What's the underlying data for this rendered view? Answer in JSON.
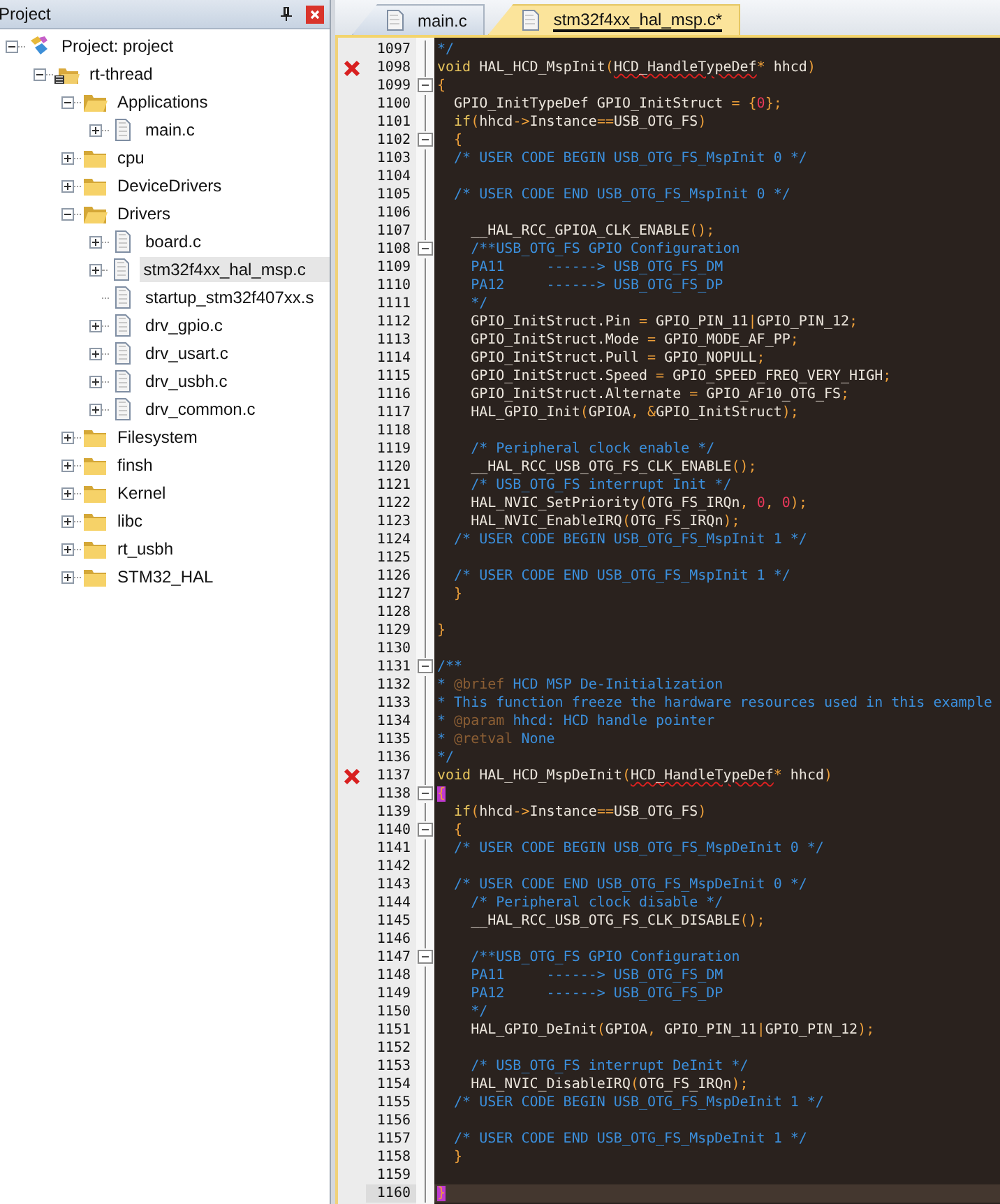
{
  "project_panel": {
    "title": "Project",
    "tree": [
      {
        "label": "Project: project",
        "kind": "project",
        "expandable": true,
        "expanded": true,
        "selected": false,
        "children": [
          {
            "label": "rt-thread",
            "kind": "target",
            "expandable": true,
            "expanded": true,
            "selected": false,
            "children": [
              {
                "label": "Applications",
                "kind": "folder_open",
                "expandable": true,
                "expanded": true,
                "selected": false,
                "children": [
                  {
                    "label": "main.c",
                    "kind": "file",
                    "expandable": true,
                    "expanded": false,
                    "selected": false
                  }
                ]
              },
              {
                "label": "cpu",
                "kind": "folder",
                "expandable": true,
                "expanded": false,
                "selected": false
              },
              {
                "label": "DeviceDrivers",
                "kind": "folder",
                "expandable": true,
                "expanded": false,
                "selected": false
              },
              {
                "label": "Drivers",
                "kind": "folder_open",
                "expandable": true,
                "expanded": true,
                "selected": false,
                "children": [
                  {
                    "label": "board.c",
                    "kind": "file",
                    "expandable": true,
                    "expanded": false,
                    "selected": false
                  },
                  {
                    "label": "stm32f4xx_hal_msp.c",
                    "kind": "file",
                    "expandable": true,
                    "expanded": false,
                    "selected": true
                  },
                  {
                    "label": "startup_stm32f407xx.s",
                    "kind": "file",
                    "expandable": false,
                    "selected": false
                  },
                  {
                    "label": "drv_gpio.c",
                    "kind": "file",
                    "expandable": true,
                    "expanded": false,
                    "selected": false
                  },
                  {
                    "label": "drv_usart.c",
                    "kind": "file",
                    "expandable": true,
                    "expanded": false,
                    "selected": false
                  },
                  {
                    "label": "drv_usbh.c",
                    "kind": "file",
                    "expandable": true,
                    "expanded": false,
                    "selected": false
                  },
                  {
                    "label": "drv_common.c",
                    "kind": "file",
                    "expandable": true,
                    "expanded": false,
                    "selected": false
                  }
                ]
              },
              {
                "label": "Filesystem",
                "kind": "folder",
                "expandable": true,
                "expanded": false,
                "selected": false
              },
              {
                "label": "finsh",
                "kind": "folder",
                "expandable": true,
                "expanded": false,
                "selected": false
              },
              {
                "label": "Kernel",
                "kind": "folder",
                "expandable": true,
                "expanded": false,
                "selected": false
              },
              {
                "label": "libc",
                "kind": "folder",
                "expandable": true,
                "expanded": false,
                "selected": false
              },
              {
                "label": "rt_usbh",
                "kind": "folder",
                "expandable": true,
                "expanded": false,
                "selected": false
              },
              {
                "label": "STM32_HAL",
                "kind": "folder",
                "expandable": true,
                "expanded": false,
                "selected": false
              }
            ]
          }
        ]
      }
    ]
  },
  "editor": {
    "tabs": [
      {
        "label": "main.c",
        "selected": false
      },
      {
        "label": "stm32f4xx_hal_msp.c*",
        "selected": true
      }
    ],
    "lines": [
      {
        "number": "1097",
        "error": false,
        "current": false,
        "foldable": false,
        "segments": [
          {
            "kind": "comment",
            "text": "*/"
          }
        ]
      },
      {
        "number": "1098",
        "error": true,
        "current": false,
        "foldable": false,
        "segments": [
          {
            "kind": "keyword",
            "text": "void"
          },
          {
            "kind": "plain",
            "text": " HAL_HCD_MspInit"
          },
          {
            "kind": "punct",
            "text": "("
          },
          {
            "kind": "flagged",
            "text": "HCD_HandleTypeDef"
          },
          {
            "kind": "punct",
            "text": "*"
          },
          {
            "kind": "plain",
            "text": " hhcd"
          },
          {
            "kind": "punct",
            "text": ")"
          }
        ]
      },
      {
        "number": "1099",
        "error": false,
        "current": false,
        "foldable": true,
        "segments": [
          {
            "kind": "punct",
            "text": "{"
          }
        ]
      },
      {
        "number": "1100",
        "error": false,
        "current": false,
        "foldable": false,
        "segments": [
          {
            "kind": "plain",
            "text": "  GPIO_InitTypeDef GPIO_InitStruct "
          },
          {
            "kind": "punct",
            "text": "= {"
          },
          {
            "kind": "number",
            "text": "0"
          },
          {
            "kind": "punct",
            "text": "};"
          }
        ]
      },
      {
        "number": "1101",
        "error": false,
        "current": false,
        "foldable": false,
        "segments": [
          {
            "kind": "keyword",
            "text": "  if"
          },
          {
            "kind": "punct",
            "text": "("
          },
          {
            "kind": "plain",
            "text": "hhcd"
          },
          {
            "kind": "punct",
            "text": "->"
          },
          {
            "kind": "plain",
            "text": "Instance"
          },
          {
            "kind": "punct",
            "text": "=="
          },
          {
            "kind": "plain",
            "text": "USB_OTG_FS"
          },
          {
            "kind": "punct",
            "text": ")"
          }
        ]
      },
      {
        "number": "1102",
        "error": false,
        "current": false,
        "foldable": true,
        "segments": [
          {
            "kind": "punct",
            "text": "  {"
          }
        ]
      },
      {
        "number": "1103",
        "error": false,
        "current": false,
        "foldable": false,
        "segments": [
          {
            "kind": "comment",
            "text": "  /* USER CODE BEGIN USB_OTG_FS_MspInit 0 */"
          }
        ]
      },
      {
        "number": "1104",
        "error": false,
        "current": false,
        "foldable": false
      },
      {
        "number": "1105",
        "error": false,
        "current": false,
        "foldable": false,
        "segments": [
          {
            "kind": "comment",
            "text": "  /* USER CODE END USB_OTG_FS_MspInit 0 */"
          }
        ]
      },
      {
        "number": "1106",
        "error": false,
        "current": false,
        "foldable": false
      },
      {
        "number": "1107",
        "error": false,
        "current": false,
        "foldable": false,
        "segments": [
          {
            "kind": "plain",
            "text": "    __HAL_RCC_GPIOA_CLK_ENABLE"
          },
          {
            "kind": "punct",
            "text": "();"
          }
        ]
      },
      {
        "number": "1108",
        "error": false,
        "current": false,
        "foldable": true,
        "segments": [
          {
            "kind": "comment",
            "text": "    /**USB_OTG_FS GPIO Configuration"
          }
        ]
      },
      {
        "number": "1109",
        "error": false,
        "current": false,
        "foldable": false,
        "segments": [
          {
            "kind": "comment",
            "text": "    PA11     ------> USB_OTG_FS_DM"
          }
        ]
      },
      {
        "number": "1110",
        "error": false,
        "current": false,
        "foldable": false,
        "segments": [
          {
            "kind": "comment",
            "text": "    PA12     ------> USB_OTG_FS_DP"
          }
        ]
      },
      {
        "number": "1111",
        "error": false,
        "current": false,
        "foldable": false,
        "segments": [
          {
            "kind": "comment",
            "text": "    */"
          }
        ]
      },
      {
        "number": "1112",
        "error": false,
        "current": false,
        "foldable": false,
        "segments": [
          {
            "kind": "plain",
            "text": "    GPIO_InitStruct.Pin "
          },
          {
            "kind": "punct",
            "text": "="
          },
          {
            "kind": "plain",
            "text": " GPIO_PIN_11"
          },
          {
            "kind": "punct",
            "text": "|"
          },
          {
            "kind": "plain",
            "text": "GPIO_PIN_12"
          },
          {
            "kind": "punct",
            "text": ";"
          }
        ]
      },
      {
        "number": "1113",
        "error": false,
        "current": false,
        "foldable": false,
        "segments": [
          {
            "kind": "plain",
            "text": "    GPIO_InitStruct.Mode "
          },
          {
            "kind": "punct",
            "text": "="
          },
          {
            "kind": "plain",
            "text": " GPIO_MODE_AF_PP"
          },
          {
            "kind": "punct",
            "text": ";"
          }
        ]
      },
      {
        "number": "1114",
        "error": false,
        "current": false,
        "foldable": false,
        "segments": [
          {
            "kind": "plain",
            "text": "    GPIO_InitStruct.Pull "
          },
          {
            "kind": "punct",
            "text": "="
          },
          {
            "kind": "plain",
            "text": " GPIO_NOPULL"
          },
          {
            "kind": "punct",
            "text": ";"
          }
        ]
      },
      {
        "number": "1115",
        "error": false,
        "current": false,
        "foldable": false,
        "segments": [
          {
            "kind": "plain",
            "text": "    GPIO_InitStruct.Speed "
          },
          {
            "kind": "punct",
            "text": "="
          },
          {
            "kind": "plain",
            "text": " GPIO_SPEED_FREQ_VERY_HIGH"
          },
          {
            "kind": "punct",
            "text": ";"
          }
        ]
      },
      {
        "number": "1116",
        "error": false,
        "current": false,
        "foldable": false,
        "segments": [
          {
            "kind": "plain",
            "text": "    GPIO_InitStruct.Alternate "
          },
          {
            "kind": "punct",
            "text": "="
          },
          {
            "kind": "plain",
            "text": " GPIO_AF10_OTG_FS"
          },
          {
            "kind": "punct",
            "text": ";"
          }
        ]
      },
      {
        "number": "1117",
        "error": false,
        "current": false,
        "foldable": false,
        "segments": [
          {
            "kind": "plain",
            "text": "    HAL_GPIO_Init"
          },
          {
            "kind": "punct",
            "text": "("
          },
          {
            "kind": "plain",
            "text": "GPIOA"
          },
          {
            "kind": "punct",
            "text": ", &"
          },
          {
            "kind": "plain",
            "text": "GPIO_InitStruct"
          },
          {
            "kind": "punct",
            "text": ");"
          }
        ]
      },
      {
        "number": "1118",
        "error": false,
        "current": false,
        "foldable": false
      },
      {
        "number": "1119",
        "error": false,
        "current": false,
        "foldable": false,
        "segments": [
          {
            "kind": "comment",
            "text": "    /* Peripheral clock enable */"
          }
        ]
      },
      {
        "number": "1120",
        "error": false,
        "current": false,
        "foldable": false,
        "segments": [
          {
            "kind": "plain",
            "text": "    __HAL_RCC_USB_OTG_FS_CLK_ENABLE"
          },
          {
            "kind": "punct",
            "text": "();"
          }
        ]
      },
      {
        "number": "1121",
        "error": false,
        "current": false,
        "foldable": false,
        "segments": [
          {
            "kind": "comment",
            "text": "    /* USB_OTG_FS interrupt Init */"
          }
        ]
      },
      {
        "number": "1122",
        "error": false,
        "current": false,
        "foldable": false,
        "segments": [
          {
            "kind": "plain",
            "text": "    HAL_NVIC_SetPriority"
          },
          {
            "kind": "punct",
            "text": "("
          },
          {
            "kind": "plain",
            "text": "OTG_FS_IRQn"
          },
          {
            "kind": "punct",
            "text": ", "
          },
          {
            "kind": "number",
            "text": "0"
          },
          {
            "kind": "punct",
            "text": ", "
          },
          {
            "kind": "number",
            "text": "0"
          },
          {
            "kind": "punct",
            "text": ");"
          }
        ]
      },
      {
        "number": "1123",
        "error": false,
        "current": false,
        "foldable": false,
        "segments": [
          {
            "kind": "plain",
            "text": "    HAL_NVIC_EnableIRQ"
          },
          {
            "kind": "punct",
            "text": "("
          },
          {
            "kind": "plain",
            "text": "OTG_FS_IRQn"
          },
          {
            "kind": "punct",
            "text": ");"
          }
        ]
      },
      {
        "number": "1124",
        "error": false,
        "current": false,
        "foldable": false,
        "segments": [
          {
            "kind": "comment",
            "text": "  /* USER CODE BEGIN USB_OTG_FS_MspInit 1 */"
          }
        ]
      },
      {
        "number": "1125",
        "error": false,
        "current": false,
        "foldable": false
      },
      {
        "number": "1126",
        "error": false,
        "current": false,
        "foldable": false,
        "segments": [
          {
            "kind": "comment",
            "text": "  /* USER CODE END USB_OTG_FS_MspInit 1 */"
          }
        ]
      },
      {
        "number": "1127",
        "error": false,
        "current": false,
        "foldable": false,
        "segments": [
          {
            "kind": "punct",
            "text": "  }"
          }
        ]
      },
      {
        "number": "1128",
        "error": false,
        "current": false,
        "foldable": false
      },
      {
        "number": "1129",
        "error": false,
        "current": false,
        "foldable": false,
        "segments": [
          {
            "kind": "punct",
            "text": "}"
          }
        ]
      },
      {
        "number": "1130",
        "error": false,
        "current": false,
        "foldable": false
      },
      {
        "number": "1131",
        "error": false,
        "current": false,
        "foldable": true,
        "segments": [
          {
            "kind": "comment",
            "text": "/**"
          }
        ]
      },
      {
        "number": "1132",
        "error": false,
        "current": false,
        "foldable": false,
        "segments": [
          {
            "kind": "comment",
            "text": "* "
          },
          {
            "kind": "doctag",
            "text": "@brief"
          },
          {
            "kind": "comment",
            "text": " HCD MSP De-Initialization"
          }
        ]
      },
      {
        "number": "1133",
        "error": false,
        "current": false,
        "foldable": false,
        "segments": [
          {
            "kind": "comment",
            "text": "* This function freeze the hardware resources used in this example"
          }
        ]
      },
      {
        "number": "1134",
        "error": false,
        "current": false,
        "foldable": false,
        "segments": [
          {
            "kind": "comment",
            "text": "* "
          },
          {
            "kind": "doctag",
            "text": "@param"
          },
          {
            "kind": "comment",
            "text": " hhcd: HCD handle pointer"
          }
        ]
      },
      {
        "number": "1135",
        "error": false,
        "current": false,
        "foldable": false,
        "segments": [
          {
            "kind": "comment",
            "text": "* "
          },
          {
            "kind": "doctag",
            "text": "@retval"
          },
          {
            "kind": "comment",
            "text": " None"
          }
        ]
      },
      {
        "number": "1136",
        "error": false,
        "current": false,
        "foldable": false,
        "segments": [
          {
            "kind": "comment",
            "text": "*/"
          }
        ]
      },
      {
        "number": "1137",
        "error": true,
        "current": false,
        "foldable": false,
        "segments": [
          {
            "kind": "keyword",
            "text": "void"
          },
          {
            "kind": "plain",
            "text": " HAL_HCD_MspDeInit"
          },
          {
            "kind": "punct",
            "text": "("
          },
          {
            "kind": "flagged",
            "text": "HCD_HandleTypeDef"
          },
          {
            "kind": "punct",
            "text": "*"
          },
          {
            "kind": "plain",
            "text": " hhcd"
          },
          {
            "kind": "punct",
            "text": ")"
          }
        ]
      },
      {
        "number": "1138",
        "error": false,
        "current": false,
        "foldable": true,
        "segments": [
          {
            "kind": "match",
            "text": "{"
          }
        ]
      },
      {
        "number": "1139",
        "error": false,
        "current": false,
        "foldable": false,
        "segments": [
          {
            "kind": "keyword",
            "text": "  if"
          },
          {
            "kind": "punct",
            "text": "("
          },
          {
            "kind": "plain",
            "text": "hhcd"
          },
          {
            "kind": "punct",
            "text": "->"
          },
          {
            "kind": "plain",
            "text": "Instance"
          },
          {
            "kind": "punct",
            "text": "=="
          },
          {
            "kind": "plain",
            "text": "USB_OTG_FS"
          },
          {
            "kind": "punct",
            "text": ")"
          }
        ]
      },
      {
        "number": "1140",
        "error": false,
        "current": false,
        "foldable": true,
        "segments": [
          {
            "kind": "punct",
            "text": "  {"
          }
        ]
      },
      {
        "number": "1141",
        "error": false,
        "current": false,
        "foldable": false,
        "segments": [
          {
            "kind": "comment",
            "text": "  /* USER CODE BEGIN USB_OTG_FS_MspDeInit 0 */"
          }
        ]
      },
      {
        "number": "1142",
        "error": false,
        "current": false,
        "foldable": false
      },
      {
        "number": "1143",
        "error": false,
        "current": false,
        "foldable": false,
        "segments": [
          {
            "kind": "comment",
            "text": "  /* USER CODE END USB_OTG_FS_MspDeInit 0 */"
          }
        ]
      },
      {
        "number": "1144",
        "error": false,
        "current": false,
        "foldable": false,
        "segments": [
          {
            "kind": "comment",
            "text": "    /* Peripheral clock disable */"
          }
        ]
      },
      {
        "number": "1145",
        "error": false,
        "current": false,
        "foldable": false,
        "segments": [
          {
            "kind": "plain",
            "text": "    __HAL_RCC_USB_OTG_FS_CLK_DISABLE"
          },
          {
            "kind": "punct",
            "text": "();"
          }
        ]
      },
      {
        "number": "1146",
        "error": false,
        "current": false,
        "foldable": false
      },
      {
        "number": "1147",
        "error": false,
        "current": false,
        "foldable": true,
        "segments": [
          {
            "kind": "comment",
            "text": "    /**USB_OTG_FS GPIO Configuration"
          }
        ]
      },
      {
        "number": "1148",
        "error": false,
        "current": false,
        "foldable": false,
        "segments": [
          {
            "kind": "comment",
            "text": "    PA11     ------> USB_OTG_FS_DM"
          }
        ]
      },
      {
        "number": "1149",
        "error": false,
        "current": false,
        "foldable": false,
        "segments": [
          {
            "kind": "comment",
            "text": "    PA12     ------> USB_OTG_FS_DP"
          }
        ]
      },
      {
        "number": "1150",
        "error": false,
        "current": false,
        "foldable": false,
        "segments": [
          {
            "kind": "comment",
            "text": "    */"
          }
        ]
      },
      {
        "number": "1151",
        "error": false,
        "current": false,
        "foldable": false,
        "segments": [
          {
            "kind": "plain",
            "text": "    HAL_GPIO_DeInit"
          },
          {
            "kind": "punct",
            "text": "("
          },
          {
            "kind": "plain",
            "text": "GPIOA"
          },
          {
            "kind": "punct",
            "text": ", "
          },
          {
            "kind": "plain",
            "text": "GPIO_PIN_11"
          },
          {
            "kind": "punct",
            "text": "|"
          },
          {
            "kind": "plain",
            "text": "GPIO_PIN_12"
          },
          {
            "kind": "punct",
            "text": ");"
          }
        ]
      },
      {
        "number": "1152",
        "error": false,
        "current": false,
        "foldable": false
      },
      {
        "number": "1153",
        "error": false,
        "current": false,
        "foldable": false,
        "segments": [
          {
            "kind": "comment",
            "text": "    /* USB_OTG_FS interrupt DeInit */"
          }
        ]
      },
      {
        "number": "1154",
        "error": false,
        "current": false,
        "foldable": false,
        "segments": [
          {
            "kind": "plain",
            "text": "    HAL_NVIC_DisableIRQ"
          },
          {
            "kind": "punct",
            "text": "("
          },
          {
            "kind": "plain",
            "text": "OTG_FS_IRQn"
          },
          {
            "kind": "punct",
            "text": ");"
          }
        ]
      },
      {
        "number": "1155",
        "error": false,
        "current": false,
        "foldable": false,
        "segments": [
          {
            "kind": "comment",
            "text": "  /* USER CODE BEGIN USB_OTG_FS_MspDeInit 1 */"
          }
        ]
      },
      {
        "number": "1156",
        "error": false,
        "current": false,
        "foldable": false
      },
      {
        "number": "1157",
        "error": false,
        "current": false,
        "foldable": false,
        "segments": [
          {
            "kind": "comment",
            "text": "  /* USER CODE END USB_OTG_FS_MspDeInit 1 */"
          }
        ]
      },
      {
        "number": "1158",
        "error": false,
        "current": false,
        "foldable": false,
        "segments": [
          {
            "kind": "punct",
            "text": "  }"
          }
        ]
      },
      {
        "number": "1159",
        "error": false,
        "current": false,
        "foldable": false
      },
      {
        "number": "1160",
        "error": false,
        "current": true,
        "foldable": false,
        "segments": [
          {
            "kind": "match",
            "text": "}"
          }
        ]
      }
    ]
  }
}
